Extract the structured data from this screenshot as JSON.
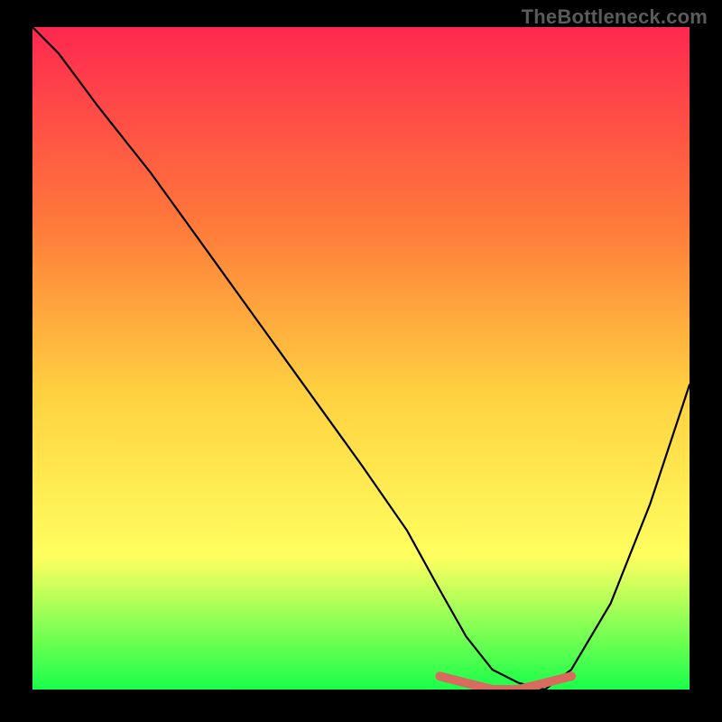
{
  "watermark": "TheBottleneck.com",
  "colors": {
    "gradient_top": "#ff2850",
    "gradient_mid1": "#ff7a3a",
    "gradient_mid2": "#ffd040",
    "gradient_mid3": "#ffff60",
    "gradient_bottom": "#18ff4a",
    "curve": "#000000",
    "accent": "#d86a5e"
  },
  "chart_data": {
    "type": "line",
    "title": "",
    "xlabel": "",
    "ylabel": "",
    "xlim": [
      0,
      100
    ],
    "ylim": [
      0,
      100
    ],
    "series": [
      {
        "name": "bottleneck-curve",
        "x": [
          0,
          4,
          10,
          18,
          26,
          34,
          42,
          50,
          57,
          62,
          66,
          70,
          74,
          78,
          82,
          88,
          94,
          100
        ],
        "y": [
          100,
          96,
          88,
          78,
          67,
          56,
          45,
          34,
          24,
          15,
          8,
          3,
          1,
          0,
          3,
          13,
          28,
          46
        ]
      }
    ],
    "accent_segment": {
      "name": "optimal-range",
      "x": [
        62,
        66,
        70,
        74,
        78,
        82
      ],
      "y": [
        2,
        1,
        0,
        0,
        1,
        2
      ]
    }
  }
}
